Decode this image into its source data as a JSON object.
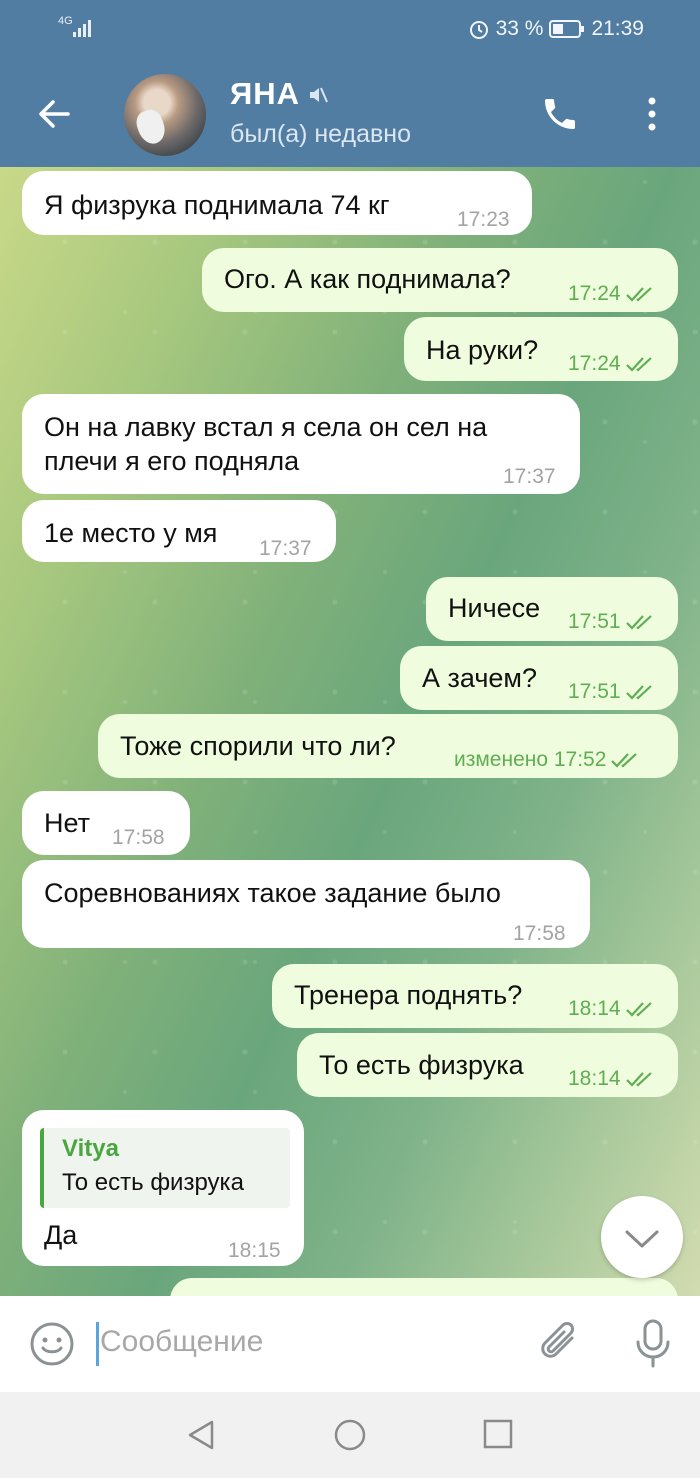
{
  "statusbar": {
    "network": "4G",
    "battery": "33 %",
    "time": "21:39"
  },
  "header": {
    "contact_name": "ЯНА",
    "status": "был(а) недавно"
  },
  "messages": [
    {
      "dir": "in",
      "text": "Я физрука поднимала 74 кг",
      "time": "17:23"
    },
    {
      "dir": "out",
      "text": "Ого. А как поднимала?",
      "time": "17:24"
    },
    {
      "dir": "out",
      "text": "На руки?",
      "time": "17:24"
    },
    {
      "dir": "in",
      "text": "Он на лавку встал я села он сел на плечи я его подняла",
      "time": "17:37"
    },
    {
      "dir": "in",
      "text": "1е место у мя",
      "time": "17:37"
    },
    {
      "dir": "out",
      "text": "Ничесе",
      "time": "17:51"
    },
    {
      "dir": "out",
      "text": "А зачем?",
      "time": "17:51"
    },
    {
      "dir": "out",
      "text": "Тоже спорили что ли?",
      "time": "изменено 17:52"
    },
    {
      "dir": "in",
      "text": "Нет",
      "time": "17:58"
    },
    {
      "dir": "in",
      "text": "Соревнованиях такое задание было",
      "time": "17:58"
    },
    {
      "dir": "out",
      "text": "Тренера поднять?",
      "time": "18:14"
    },
    {
      "dir": "out",
      "text": "То есть физрука",
      "time": "18:14"
    },
    {
      "dir": "in",
      "reply_author": "Vitya",
      "reply_text": "То есть физрука",
      "text": "Да",
      "time": "18:15"
    }
  ],
  "composer": {
    "placeholder": "Сообщение"
  },
  "colors": {
    "header": "#527da3",
    "incoming": "#ffffff",
    "outgoing": "#effdde",
    "out_time": "#5fae52"
  }
}
